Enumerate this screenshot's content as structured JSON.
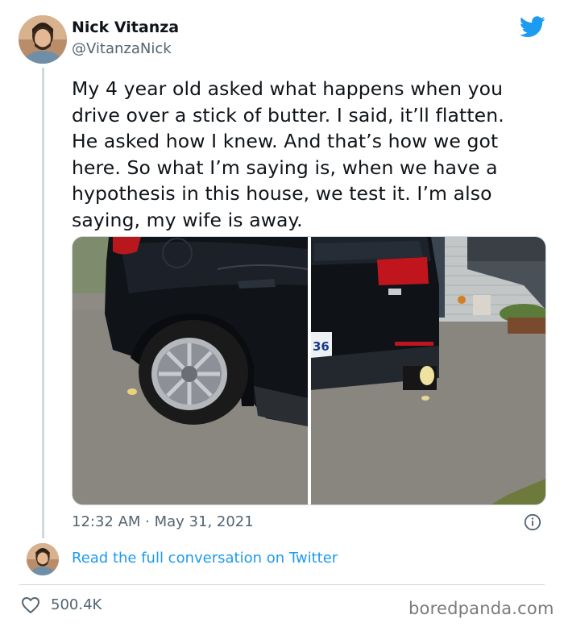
{
  "author": {
    "display_name": "Nick Vitanza",
    "handle": "@VitanzaNick"
  },
  "tweet": {
    "text": "My 4 year old asked what happens when you\ndrive over a stick of butter. I said, it’ll flatten.\nHe asked how I knew. And that’s how we got\nhere. So what I’m saying is, when we have a\nhypothesis in this house, we test it. I’m also\nsaying, my wife is away.",
    "timestamp": "12:32 AM · May 31, 2021",
    "like_count": "500.4K"
  },
  "media": {
    "license_plate_text": "36"
  },
  "footer": {
    "read_link": "Read the full conversation on Twitter",
    "watermark": "boredpanda.com"
  },
  "colors": {
    "twitter_blue": "#1d9bf0",
    "secondary_text": "#536471"
  },
  "icons": {
    "brand": "twitter-bird-icon",
    "info": "info-icon",
    "like": "heart-icon"
  }
}
